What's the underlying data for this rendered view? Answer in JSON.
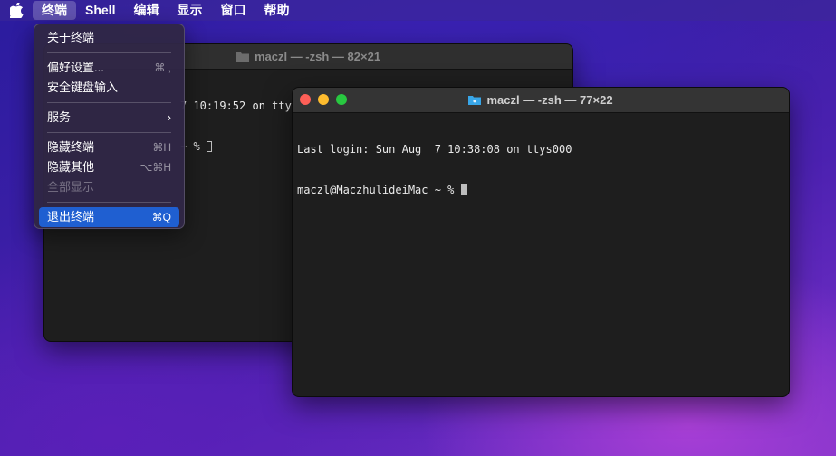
{
  "menubar": {
    "apple_icon": "apple-logo-icon",
    "items": [
      {
        "label": "终端"
      },
      {
        "label": "Shell"
      },
      {
        "label": "编辑"
      },
      {
        "label": "显示"
      },
      {
        "label": "窗口"
      },
      {
        "label": "帮助"
      }
    ]
  },
  "terminal_menu": {
    "about": "关于终端",
    "preferences": {
      "label": "偏好设置...",
      "shortcut": "⌘ ,"
    },
    "secure_keyboard": "安全键盘输入",
    "services": "服务",
    "hide": {
      "label": "隐藏终端",
      "shortcut": "⌘H"
    },
    "hide_others": {
      "label": "隐藏其他",
      "shortcut": "⌥⌘H"
    },
    "show_all": "全部显示",
    "quit": {
      "label": "退出终端",
      "shortcut": "⌘Q"
    }
  },
  "back_window": {
    "title": "maczl — -zsh — 82×21",
    "lines": [
      "7 10:19:52 on ttys000",
      "~ % "
    ]
  },
  "front_window": {
    "title": "maczl — -zsh — 77×22",
    "lines": [
      "Last login: Sun Aug  7 10:38:08 on ttys000",
      "maczl@MaczhulideiMac ~ % "
    ]
  },
  "colors": {
    "highlight": "#1f5fd1",
    "terminal_bg": "#1e1e1e",
    "folder_icon": "#38a6e8"
  }
}
